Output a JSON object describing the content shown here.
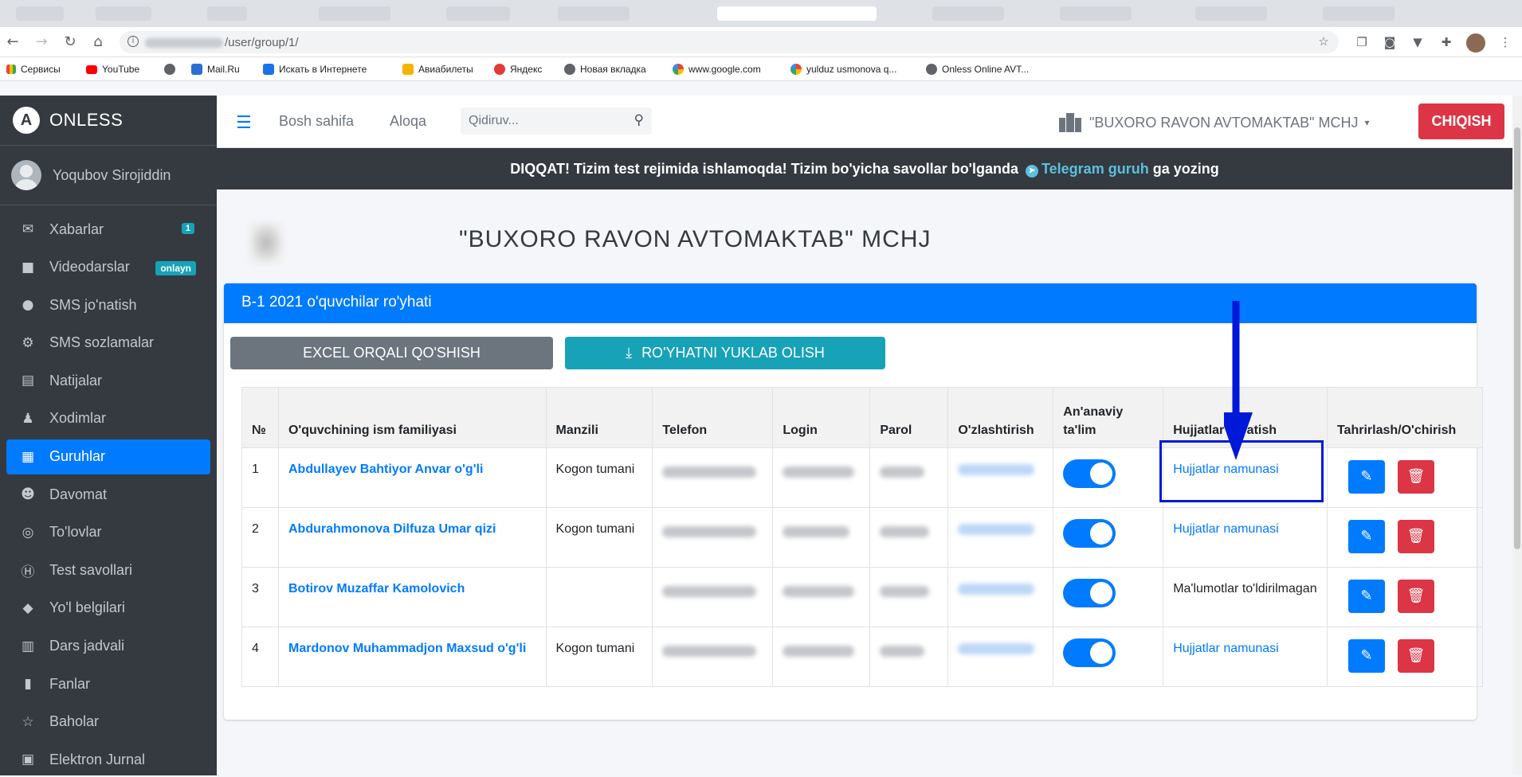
{
  "browser": {
    "url_path": "/user/group/1/",
    "bookmarks": [
      "Сервисы",
      "YouTube",
      "",
      "Mail.Ru",
      "Искать в Интернете",
      "Авиабилеты",
      "Яндекс",
      "Новая вкладка",
      "www.google.com",
      "yulduz usmonova q...",
      "Onless Online AVT..."
    ]
  },
  "sidebar": {
    "brand": "ONLESS",
    "user_name": "Yoqubov Sirojiddin",
    "items": [
      {
        "label": "Xabarlar",
        "badge": "1"
      },
      {
        "label": "Videodarslar",
        "badge": "onlayn"
      },
      {
        "label": "SMS jo'natish"
      },
      {
        "label": "SMS sozlamalar"
      },
      {
        "label": "Natijalar"
      },
      {
        "label": "Xodimlar"
      },
      {
        "label": "Guruhlar"
      },
      {
        "label": "Davomat"
      },
      {
        "label": "To'lovlar"
      },
      {
        "label": "Test savollari"
      },
      {
        "label": "Yo'l belgilari"
      },
      {
        "label": "Dars jadvali"
      },
      {
        "label": "Fanlar"
      },
      {
        "label": "Baholar"
      },
      {
        "label": "Elektron Jurnal"
      }
    ]
  },
  "topnav": {
    "home": "Bosh sahifa",
    "contact": "Aloqa",
    "search_placeholder": "Qidiruv...",
    "org": "\"BUXORO RAVON AVTOMAKTAB\" MCHJ",
    "logout": "CHIQISH"
  },
  "notice": {
    "text_before": "DIQQAT! Tizim test rejimida ishlamoqda! Tizim bo'yicha savollar bo'lganda",
    "link": "Telegram guruh",
    "text_after": "ga yozing"
  },
  "page": {
    "org_title": "\"BUXORO RAVON AVTOMAKTAB\" MCHJ",
    "card_title": "B-1 2021 o'quvchilar ro'yhati",
    "btn_excel": "EXCEL ORQALI QO'SHISH",
    "btn_download": "RO'YHATNI YUKLAB OLISH"
  },
  "table": {
    "headers": [
      "№",
      "O'quvchining ism familiyasi",
      "Manzili",
      "Telefon",
      "Login",
      "Parol",
      "O'zlashtirish",
      "An'anaviy ta'lim",
      "Hujjatlar yaratish",
      "Tahrirlash/O'chirish"
    ],
    "rows": [
      {
        "num": "1",
        "name": "Abdullayev Bahtiyor Anvar o'g'li",
        "address": "Kogon tumani",
        "docs": "Hujjatlar namunasi",
        "docs_is_link": true
      },
      {
        "num": "2",
        "name": "Abdurahmonova Dilfuza Umar qizi",
        "address": "Kogon tumani",
        "docs": "Hujjatlar namunasi",
        "docs_is_link": true
      },
      {
        "num": "3",
        "name": "Botirov Muzaffar Kamolovich",
        "address": "",
        "docs": "Ma'lumotlar to'ldirilmagan",
        "docs_is_link": false
      },
      {
        "num": "4",
        "name": "Mardonov Muhammadjon Maxsud o'g'li",
        "address": "Kogon tumani",
        "docs": "Hujjatlar namunasi",
        "docs_is_link": true
      }
    ]
  },
  "colors": {
    "primary": "#007bff",
    "danger": "#dc3545",
    "info": "#17a2b8",
    "sidebar": "#343a40",
    "annotation": "#0018d8"
  }
}
